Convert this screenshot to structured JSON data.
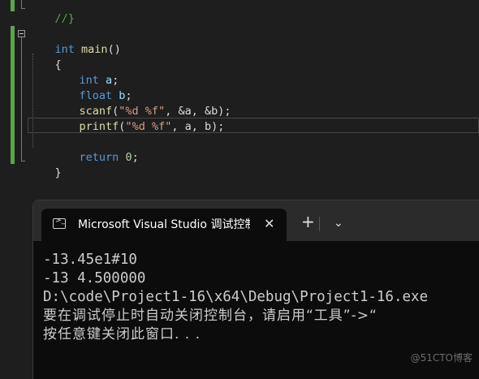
{
  "editor": {
    "lines": {
      "comment": "//}",
      "main_type": "int",
      "main_name": "main",
      "main_parens": "()",
      "open_brace": "{",
      "decl_a_type": "int",
      "decl_a_name": "a",
      "decl_b_type": "float",
      "decl_b_name": "b",
      "scanf_name": "scanf",
      "scanf_fmt": "\"%d %f\"",
      "scanf_args": ", &a, &b);",
      "printf_name": "printf",
      "printf_fmt": "\"%d %f\"",
      "printf_args": ", a, b);",
      "return_kw": "return",
      "return_val": "0",
      "close_brace": "}",
      "semicolon": ";",
      "lparen": "("
    }
  },
  "terminal": {
    "tab_title": "Microsoft Visual Studio 调试控制台",
    "tab_close": "✕",
    "new_tab": "+",
    "dropdown": "⌄",
    "output": [
      "-13.45e1#10",
      "-13 4.500000",
      "D:\\code\\Project1-16\\x64\\Debug\\Project1-16.exe",
      "要在调试停止时自动关闭控制台，请启用“工具”->“",
      "按任意键关闭此窗口. . ."
    ]
  },
  "watermark": "@51CTO博客"
}
